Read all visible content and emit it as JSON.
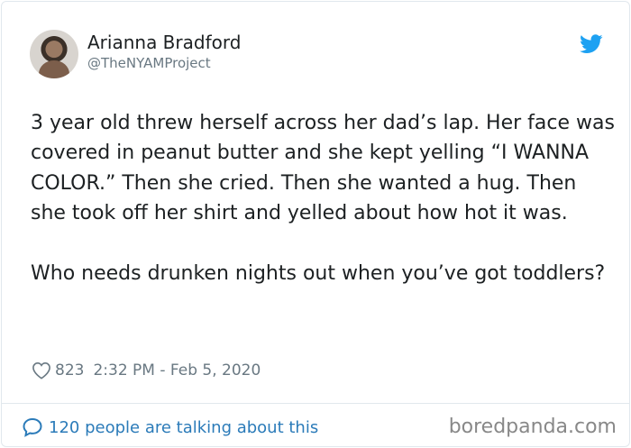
{
  "user": {
    "name": "Arianna Bradford",
    "handle": "@TheNYAMProject"
  },
  "tweet": {
    "text": "3 year old threw herself across her dad’s lap. Her face was covered in peanut butter and she kept yelling “I WANNA COLOR.” Then she cried. Then she wanted a hug. Then she took off her shirt and yelled about how hot it was.\n\nWho needs drunken nights out when you’ve got toddlers?",
    "likes": "823",
    "timestamp": "2:32 PM - Feb 5, 2020"
  },
  "footer": {
    "talking": "120 people are talking about this",
    "watermark": "boredpanda.com"
  },
  "icons": {
    "bird": "twitter-bird-icon",
    "heart": "heart-icon",
    "bubble": "speech-bubble-icon"
  },
  "colors": {
    "twitter_blue": "#1da1f2",
    "link_blue": "#2b7bb9",
    "meta_gray": "#697882"
  }
}
